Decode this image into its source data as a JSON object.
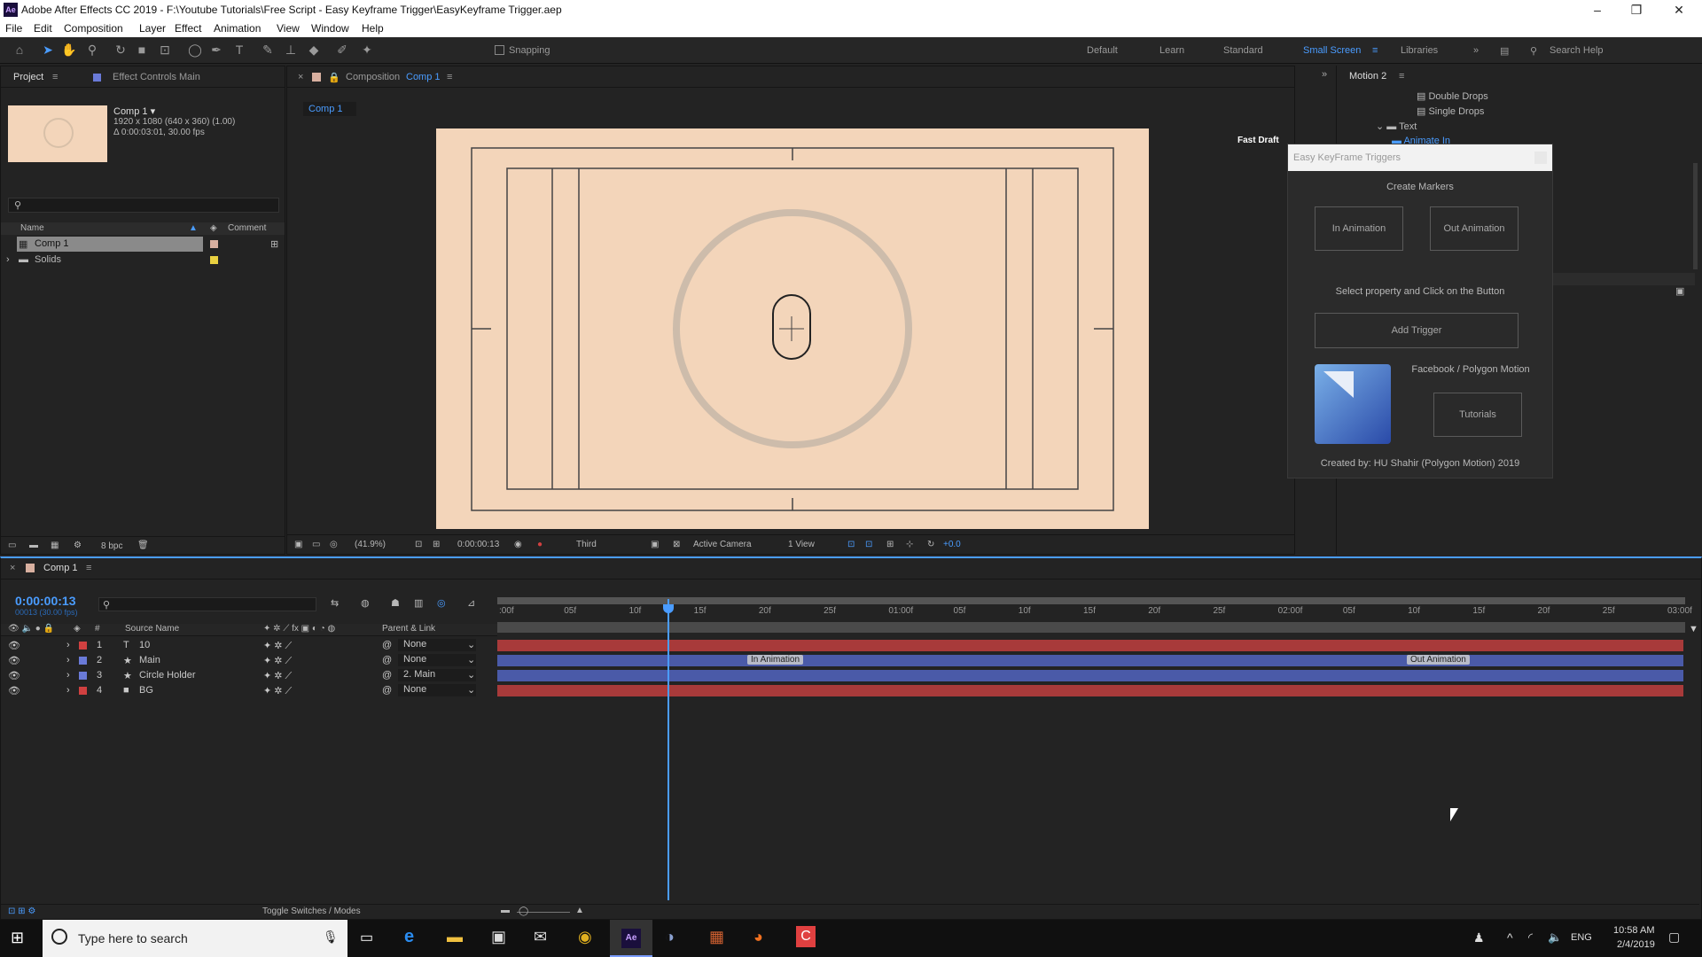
{
  "window": {
    "title": "Adobe After Effects CC 2019 - F:\\Youtube Tutorials\\Free Script - Easy Keyframe Trigger\\EasyKeyframe Trigger.aep",
    "app_badge": "Ae"
  },
  "menu": [
    "File",
    "Edit",
    "Composition",
    "Layer",
    "Effect",
    "Animation",
    "View",
    "Window",
    "Help"
  ],
  "toolbar": {
    "snapping": "Snapping",
    "workspaces": [
      "Default",
      "Learn",
      "Standard",
      "Small Screen",
      "Libraries"
    ],
    "active_workspace": "Small Screen",
    "search_placeholder": "Search Help"
  },
  "project": {
    "tab": "Project",
    "effect_tab": "Effect Controls Main",
    "comp_name": "Comp 1 ▾",
    "comp_info1": "1920 x 1080  (640 x 360) (1.00)",
    "comp_info2": "Δ 0:00:03:01, 30.00 fps",
    "col_name": "Name",
    "col_comment": "Comment",
    "items": [
      {
        "name": "Comp 1",
        "color": "#d8b0a0"
      },
      {
        "name": "Solids",
        "color": "#e8d040"
      }
    ],
    "bpc": "8 bpc"
  },
  "composition": {
    "tab_label": "Composition",
    "tab_comp": "Comp 1",
    "sub_tab": "Comp 1",
    "fast_draft": "Fast Draft",
    "zoom": "(41.9%)",
    "timecode": "0:00:00:13",
    "resolution": "Third",
    "camera": "Active Camera",
    "views": "1 View",
    "exposure": "+0.0",
    "canvas_color": "#f3d5ba"
  },
  "motion": {
    "tab": "Motion 2",
    "tree": [
      "Double Drops",
      "Single Drops",
      "Text",
      "Animate In"
    ],
    "plugin_title": "Easy KeyFrame Triggers",
    "create_markers": "Create Markers",
    "in_btn": "In Animation",
    "out_btn": "Out Animation",
    "instruction": "Select property and Click on the Button",
    "add_trigger": "Add Trigger",
    "facebook": "Facebook / Polygon Motion",
    "tutorials": "Tutorials",
    "credit": "Created by: HU Shahir (Polygon Motion) 2019"
  },
  "timeline": {
    "tab": "Comp 1",
    "timecode": "0:00:00:13",
    "frame_info": "00013 (30.00 fps)",
    "col_source": "Source Name",
    "col_parent": "Parent & Link",
    "toggle": "Toggle Switches / Modes",
    "ticks": [
      ":00f",
      "05f",
      "10f",
      "15f",
      "20f",
      "25f",
      "01:00f",
      "05f",
      "10f",
      "15f",
      "20f",
      "25f",
      "02:00f",
      "05f",
      "10f",
      "15f",
      "20f",
      "25f",
      "03:00f"
    ],
    "layers": [
      {
        "num": "1",
        "type": "T",
        "name": "10",
        "parent": "None",
        "color": "#d04040",
        "bar": "#a83a3a"
      },
      {
        "num": "2",
        "type": "★",
        "name": "Main",
        "parent": "None",
        "color": "#6a7ad8",
        "bar": "#4a5aa8"
      },
      {
        "num": "3",
        "type": "★",
        "name": "Circle Holder",
        "parent": "2. Main",
        "color": "#6a7ad8",
        "bar": "#4a5aa8"
      },
      {
        "num": "4",
        "type": "■",
        "name": "BG",
        "parent": "None",
        "color": "#d04040",
        "bar": "#a83a3a"
      }
    ],
    "markers": {
      "in": "In Animation",
      "out": "Out Animation"
    },
    "playhead_fraction": 0.144
  },
  "taskbar": {
    "search": "Type here to search",
    "lang": "ENG",
    "time": "10:58 AM",
    "date": "2/4/2019"
  }
}
